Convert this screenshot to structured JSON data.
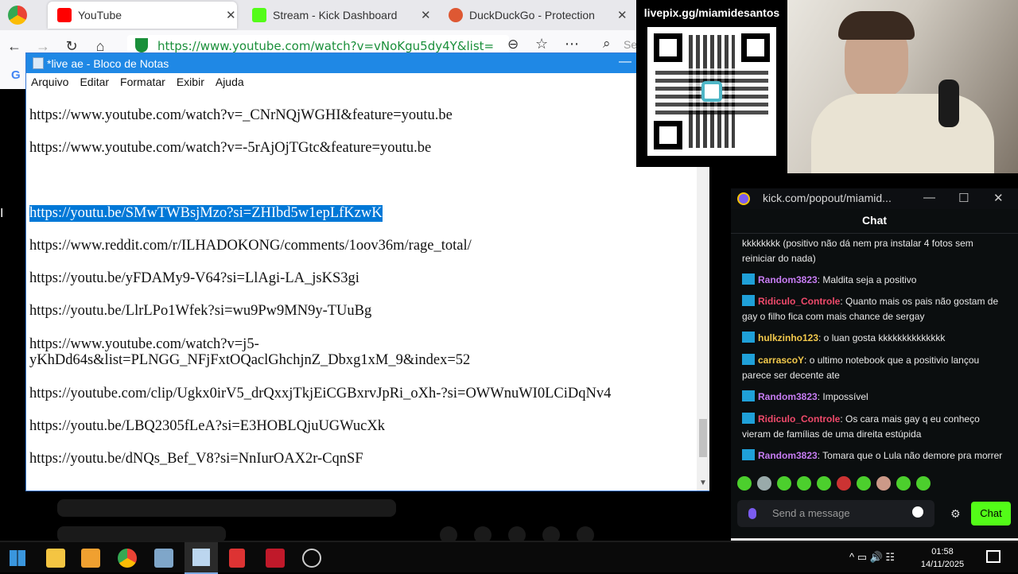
{
  "browser": {
    "tabs": [
      {
        "label": "YouTube",
        "color": "#ff0000"
      },
      {
        "label": "Stream - Kick Dashboard",
        "color": "#53fc18"
      },
      {
        "label": "DuckDuckGo - Protection",
        "color": "#de5833"
      }
    ],
    "url": "https://www.youtube.com/watch?v=vNoKgu5dy4Y&list=",
    "search_placeholder": "Se"
  },
  "notepad": {
    "title": "*live ae - Bloco de Notas",
    "menu": [
      "Arquivo",
      "Editar",
      "Formatar",
      "Exibir",
      "Ajuda"
    ],
    "lines": [
      "https://www.youtube.com/watch?v=_CNrNQjWGHI&feature=youtu.be",
      "https://www.youtube.com/watch?v=-5rAjOjTGtc&feature=youtu.be",
      "https://youtu.be/SMwTWBsjMzo?si=ZHIbd5w1epLfKzwK",
      "https://www.reddit.com/r/ILHADOKONG/comments/1oov36m/rage_total/",
      "https://youtu.be/yFDAMy9-V64?si=LlAgi-LA_jsKS3gi",
      "https://youtu.be/LlrLPo1Wfek?si=wu9Pw9MN9y-TUuBg",
      "https://www.youtube.com/watch?v=j5-",
      "yKhDd64s&list=PLNGG_NFjFxtOQaclGhchjnZ_Dbxg1xM_9&index=52",
      "https://youtube.com/clip/Ugkx0irV5_drQxxjTkjEiCGBxrvJpRi_oXh-?si=OWWnuWI0LCiDqNv4",
      "https://youtu.be/LBQ2305fLeA?si=E3HOBLQjuUGWucXk",
      "https://youtu.be/dNQs_Bef_V8?si=NnIurOAX2r-CqnSF"
    ]
  },
  "qr": {
    "label": "livepix.gg/miamidesantos"
  },
  "kick": {
    "title": "kick.com/popout/miamid...",
    "chat_header": "Chat",
    "messages": [
      {
        "user": "",
        "text": "kkkkkkkk (positivo não dá nem pra instalar 4 fotos sem reiniciar do nada)",
        "color": "#e8e8e8"
      },
      {
        "user": "Random3823",
        "text": ": Maldita seja a positivo",
        "color": "#c67cf2"
      },
      {
        "user": "Ridiculo_Controle",
        "text": ": Quanto mais os pais não gostam de gay o filho fica com mais chance de sergay",
        "color": "#ef4a6b"
      },
      {
        "user": "hulkzinho123",
        "text": ": o luan gosta kkkkkkkkkkkkkk",
        "color": "#f2c94c"
      },
      {
        "user": "carrascoY",
        "text": ": o ultimo notebook que a positivio lançou parece ser decente ate",
        "color": "#f2c94c"
      },
      {
        "user": "Random3823",
        "text": ": Impossível",
        "color": "#c67cf2"
      },
      {
        "user": "Ridiculo_Controle",
        "text": ": Os cara mais gay q eu conheço vieram de famílias de uma direita estúpida",
        "color": "#ef4a6b"
      },
      {
        "user": "Random3823",
        "text": ": Tomara que o Lula não demore pra morrer",
        "color": "#c67cf2"
      }
    ],
    "input_placeholder": "Send a message",
    "send_label": "Chat"
  },
  "taskbar": {
    "time": "01:58",
    "date": "14/11/2025"
  }
}
